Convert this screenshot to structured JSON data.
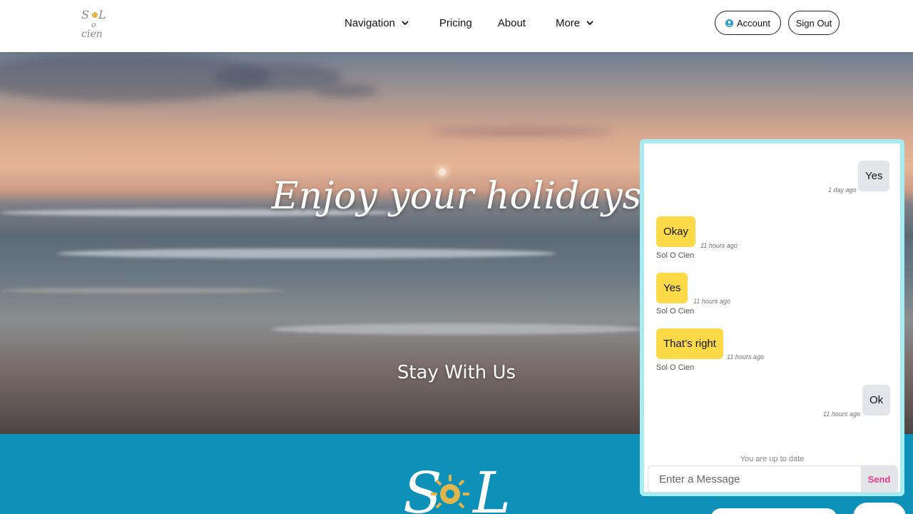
{
  "header": {
    "logo_alt": "Sol o Cien",
    "nav": [
      {
        "label": "Navigation",
        "has_dropdown": true
      },
      {
        "label": "Pricing",
        "has_dropdown": false
      },
      {
        "label": "About",
        "has_dropdown": false
      },
      {
        "label": "More",
        "has_dropdown": true
      }
    ],
    "account_label": "Account",
    "signout_label": "Sign Out"
  },
  "hero": {
    "title": "Enjoy your holidays",
    "subtitle": "Stay With Us"
  },
  "chat": {
    "messages": [
      {
        "text": "Yes",
        "time": "1 day ago",
        "direction": "out",
        "sender": ""
      },
      {
        "text": "Okay",
        "time": "11 hours ago",
        "direction": "in",
        "sender": "Sol O Cien"
      },
      {
        "text": "Yes",
        "time": "11 hours ago",
        "direction": "in",
        "sender": "Sol O Cien"
      },
      {
        "text": "That’s right",
        "time": "11 hours ago",
        "direction": "in",
        "sender": "Sol O Cien"
      },
      {
        "text": "Ok",
        "time": "11 hours ago",
        "direction": "out",
        "sender": ""
      }
    ],
    "status": "You are up to date",
    "input_placeholder": "Enter a Message",
    "send_label": "Send"
  },
  "colors": {
    "accent_teal": "#0d91b8",
    "incoming_bubble": "#fbd947",
    "outgoing_bubble": "#e4e5ea",
    "send_text": "#e33d8b",
    "chat_border": "#a7ecf2"
  }
}
